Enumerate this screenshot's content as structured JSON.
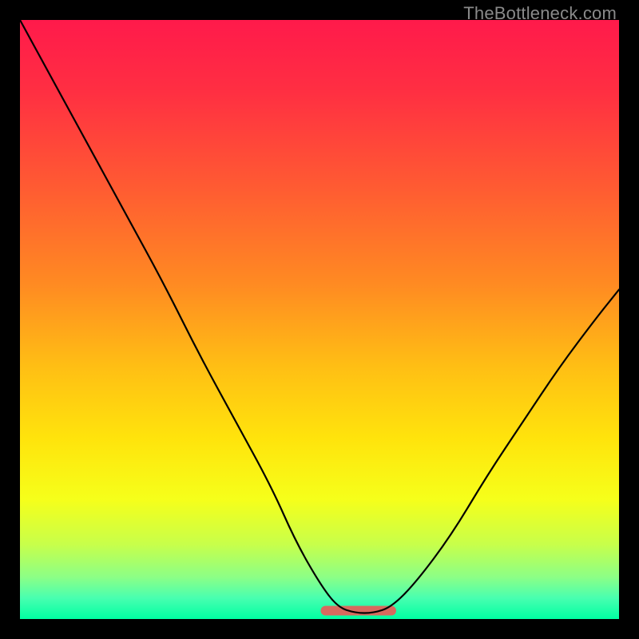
{
  "watermark": "TheBottleneck.com",
  "colors": {
    "frame": "#000000",
    "curve": "#000000",
    "band": "#d86a5e",
    "gradient_stops": [
      {
        "offset": 0.0,
        "color": "#ff1a4b"
      },
      {
        "offset": 0.12,
        "color": "#ff2f42"
      },
      {
        "offset": 0.28,
        "color": "#ff5b32"
      },
      {
        "offset": 0.44,
        "color": "#ff8a22"
      },
      {
        "offset": 0.58,
        "color": "#ffbf14"
      },
      {
        "offset": 0.7,
        "color": "#ffe40c"
      },
      {
        "offset": 0.8,
        "color": "#f6ff1a"
      },
      {
        "offset": 0.875,
        "color": "#c8ff4a"
      },
      {
        "offset": 0.93,
        "color": "#8cff86"
      },
      {
        "offset": 0.965,
        "color": "#48ffb0"
      },
      {
        "offset": 1.0,
        "color": "#00ffa2"
      }
    ]
  },
  "chart_data": {
    "type": "line",
    "title": "",
    "xlabel": "",
    "ylabel": "",
    "xlim": [
      0,
      100
    ],
    "ylim": [
      0,
      100
    ],
    "series": [
      {
        "name": "bottleneck-curve",
        "x": [
          0,
          6,
          12,
          18,
          24,
          30,
          36,
          42,
          46,
          50,
          53,
          56,
          59,
          62,
          66,
          72,
          78,
          84,
          90,
          96,
          100
        ],
        "y": [
          100,
          89,
          78,
          67,
          56,
          44,
          33,
          22,
          13,
          6,
          2,
          1,
          1,
          2,
          6,
          14,
          24,
          33,
          42,
          50,
          55
        ]
      }
    ],
    "flat_band": {
      "name": "sweet-spot-band",
      "x_start": 51,
      "x_end": 62,
      "y": 1.4,
      "thickness_pct": 1.6
    }
  }
}
